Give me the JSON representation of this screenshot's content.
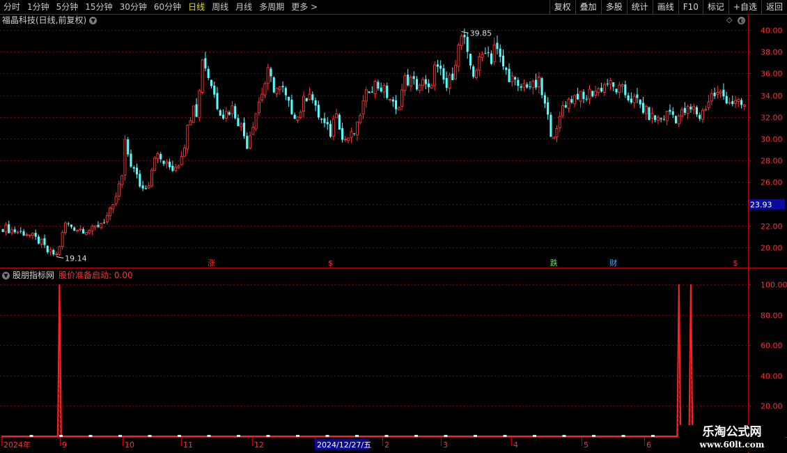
{
  "toolbar": {
    "periods": [
      {
        "label": "分时",
        "active": false
      },
      {
        "label": "1分钟",
        "active": false
      },
      {
        "label": "5分钟",
        "active": false
      },
      {
        "label": "15分钟",
        "active": false
      },
      {
        "label": "30分钟",
        "active": false
      },
      {
        "label": "60分钟",
        "active": false
      },
      {
        "label": "日线",
        "active": true
      },
      {
        "label": "周线",
        "active": false
      },
      {
        "label": "月线",
        "active": false
      },
      {
        "label": "多周期",
        "active": false
      },
      {
        "label": "更多 >",
        "active": false
      }
    ],
    "buttons": [
      "复权",
      "叠加",
      "多股",
      "统计",
      "画线",
      "F10",
      "标记",
      "+自选",
      "返回"
    ]
  },
  "price_panel": {
    "title": "福晶科技(日线,前复权)",
    "high_label": "39.85",
    "low_label": "19.14",
    "current_price_tag": "23.93",
    "markers": [
      {
        "text": "涨",
        "color": "#ff3030"
      },
      {
        "text": "$",
        "color": "#ff3030"
      },
      {
        "text": "跌",
        "color": "#30ff30"
      },
      {
        "text": "财",
        "color": "#4aa8ff"
      },
      {
        "text": "$",
        "color": "#ff3030"
      }
    ]
  },
  "indicator_panel": {
    "title": "股朋指标网",
    "value_label": "股价准备启动: 0.00"
  },
  "date_axis": {
    "labels": [
      "2024年",
      "9",
      "10",
      "11",
      "12",
      "2024/12/27/五",
      "2",
      "3",
      "4",
      "5",
      "6"
    ]
  },
  "watermark": {
    "name": "乐淘公式网",
    "url": "www.60lt.com"
  },
  "colors": {
    "up": "#ff3333",
    "down": "#54ffff",
    "grid": "#7a0000",
    "axis": "#c00000",
    "signal": "#ff2020"
  },
  "chart_data": [
    {
      "type": "candlestick",
      "title": "",
      "ylim": [
        19,
        40.5
      ],
      "y_ticks": [
        20,
        22,
        24,
        26,
        28,
        30,
        32,
        34,
        36,
        38,
        40
      ],
      "grid": true,
      "annotations": [
        {
          "label": "39.85",
          "value": 39.85
        },
        {
          "label": "19.14",
          "value": 19.14
        },
        {
          "label": "23.93",
          "value": 23.93
        }
      ],
      "x_ticks": [
        "2024年",
        "9",
        "10",
        "11",
        "12",
        "2024/12/27/五",
        "2",
        "3",
        "4",
        "5",
        "6"
      ],
      "close_path": [
        [
          0,
          21.8
        ],
        [
          4,
          21.5
        ],
        [
          8,
          21.3
        ],
        [
          13,
          20.4
        ],
        [
          15,
          19.6
        ],
        [
          18,
          19.3
        ],
        [
          19,
          20.2
        ],
        [
          21,
          22.2
        ],
        [
          25,
          21.7
        ],
        [
          30,
          21.6
        ],
        [
          34,
          22.5
        ],
        [
          37,
          23.6
        ],
        [
          38,
          24.7
        ],
        [
          40,
          26.5
        ],
        [
          41,
          29.5
        ],
        [
          43,
          27.7
        ],
        [
          46,
          25.8
        ],
        [
          47,
          25.4
        ],
        [
          49,
          26.0
        ],
        [
          51,
          28.6
        ],
        [
          55,
          27.5
        ],
        [
          57,
          27.3
        ],
        [
          59,
          27.8
        ],
        [
          61,
          29.6
        ],
        [
          64,
          33.5
        ],
        [
          65,
          32.5
        ],
        [
          66,
          34.3
        ],
        [
          67,
          37.6
        ],
        [
          68,
          36.6
        ],
        [
          70,
          35.0
        ],
        [
          72,
          33.1
        ],
        [
          74,
          32.2
        ],
        [
          77,
          32.8
        ],
        [
          80,
          31.1
        ],
        [
          82,
          29.5
        ],
        [
          84,
          31.5
        ],
        [
          86,
          33.4
        ],
        [
          89,
          36.0
        ],
        [
          91,
          34.7
        ],
        [
          94,
          34.4
        ],
        [
          96,
          33.0
        ],
        [
          99,
          32.0
        ],
        [
          101,
          33.4
        ],
        [
          103,
          34.5
        ],
        [
          105,
          32.6
        ],
        [
          108,
          31.2
        ],
        [
          110,
          30.5
        ],
        [
          112,
          32.8
        ],
        [
          114,
          29.9
        ],
        [
          117,
          30.2
        ],
        [
          119,
          31.0
        ],
        [
          120,
          32.4
        ],
        [
          123,
          34.7
        ],
        [
          125,
          35.0
        ],
        [
          127,
          34.7
        ],
        [
          130,
          33.7
        ],
        [
          132,
          32.4
        ],
        [
          135,
          35.4
        ],
        [
          137,
          35.3
        ],
        [
          139,
          34.9
        ],
        [
          141,
          35.1
        ],
        [
          143,
          34.3
        ],
        [
          145,
          36.5
        ],
        [
          147,
          35.9
        ],
        [
          149,
          34.7
        ],
        [
          151,
          36.0
        ],
        [
          152,
          37.3
        ],
        [
          154,
          39.4
        ],
        [
          155,
          38.8
        ],
        [
          156,
          37.4
        ],
        [
          158,
          36.0
        ],
        [
          160,
          37.0
        ],
        [
          162,
          38.4
        ],
        [
          164,
          37.3
        ],
        [
          165,
          38.7
        ],
        [
          167,
          37.2
        ],
        [
          169,
          36.1
        ],
        [
          171,
          35.5
        ],
        [
          173,
          34.5
        ],
        [
          176,
          35.1
        ],
        [
          178,
          34.7
        ],
        [
          180,
          35.1
        ],
        [
          182,
          33.0
        ],
        [
          184,
          30.7
        ],
        [
          186,
          30.5
        ],
        [
          188,
          33.1
        ],
        [
          190,
          33.5
        ],
        [
          193,
          34.1
        ],
        [
          195,
          33.5
        ],
        [
          197,
          34.2
        ],
        [
          200,
          34.5
        ],
        [
          203,
          35.2
        ],
        [
          205,
          34.6
        ],
        [
          208,
          34.4
        ],
        [
          210,
          33.8
        ],
        [
          213,
          33.4
        ],
        [
          215,
          32.7
        ],
        [
          218,
          31.9
        ],
        [
          221,
          31.8
        ],
        [
          224,
          32.5
        ],
        [
          226,
          31.9
        ],
        [
          229,
          32.5
        ],
        [
          232,
          32.7
        ],
        [
          234,
          32.0
        ],
        [
          236,
          33.0
        ],
        [
          238,
          34.0
        ],
        [
          241,
          34.1
        ],
        [
          244,
          33.5
        ],
        [
          247,
          33.1
        ],
        [
          249,
          33.0
        ]
      ]
    },
    {
      "type": "line",
      "title": "",
      "ylim": [
        0,
        105
      ],
      "y_ticks": [
        20,
        40,
        60,
        80,
        100
      ],
      "grid": true,
      "series": [
        {
          "name": "股价准备启动",
          "spikes": [
            {
              "x": 19,
              "value": 100
            },
            {
              "x": 227,
              "value": 100
            },
            {
              "x": 231,
              "value": 100
            }
          ],
          "baseline": 0
        }
      ]
    }
  ]
}
